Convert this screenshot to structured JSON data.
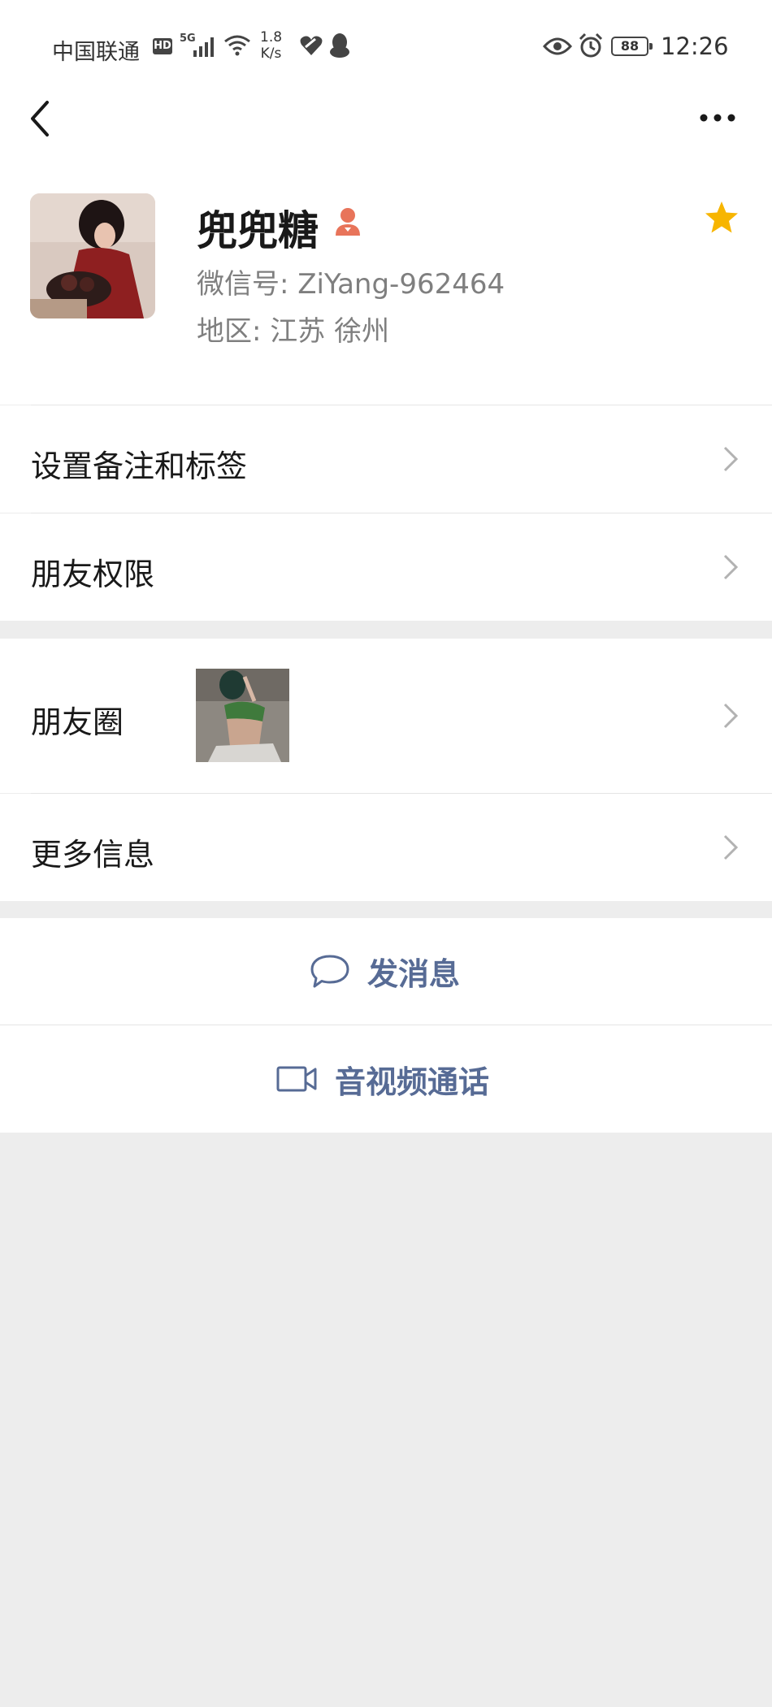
{
  "status_bar": {
    "carrier": "中国联通",
    "hd": "HD",
    "signal_type": "5G",
    "net_speed_value": "1.8",
    "net_speed_unit": "K/s",
    "battery": "88",
    "time": "12:26"
  },
  "profile": {
    "name": "兜兜糖",
    "wechat_id": "微信号: ZiYang-962464",
    "region": "地区: 江苏  徐州",
    "starred": true
  },
  "rows": {
    "remark_tags": "设置备注和标签",
    "friend_permissions": "朋友权限",
    "moments": "朋友圈",
    "more_info": "更多信息"
  },
  "actions": {
    "send_message": "发消息",
    "av_call": "音视频通话"
  },
  "colors": {
    "accent_link": "#576b95",
    "star": "#f7b500",
    "badge": "#e8745a",
    "background": "#ededed"
  }
}
